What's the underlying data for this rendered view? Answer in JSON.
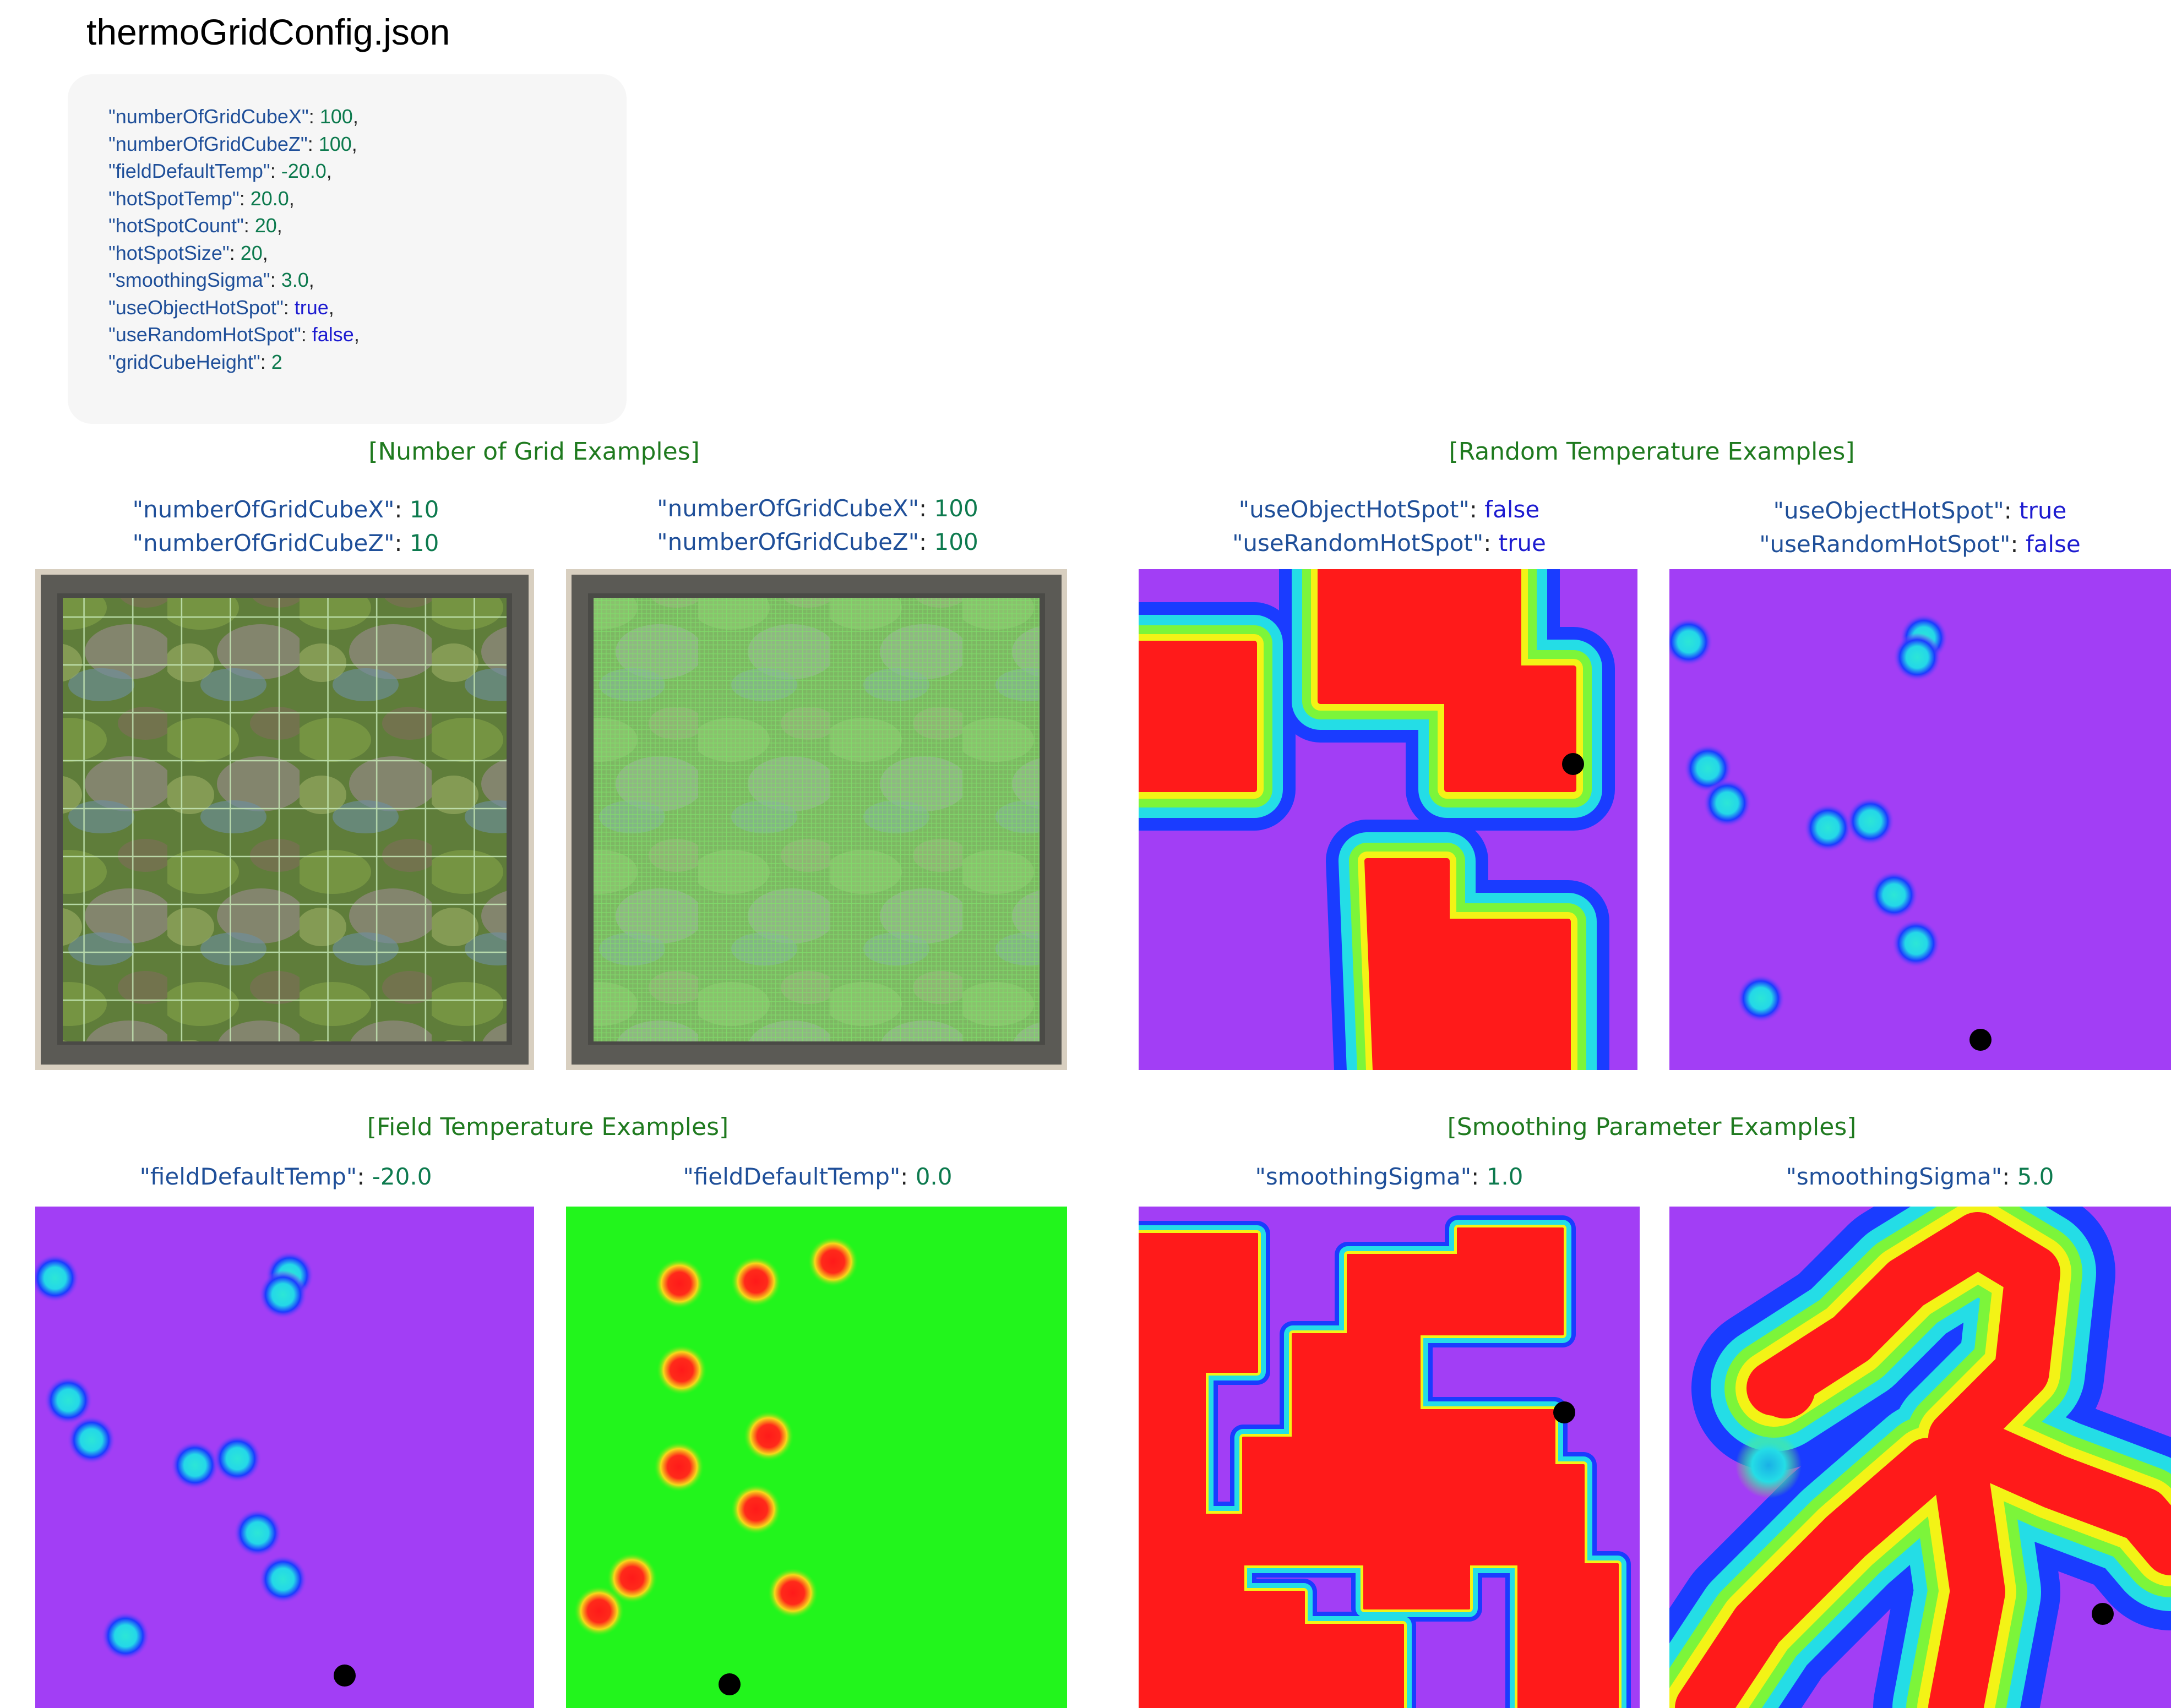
{
  "file_title": "thermoGridConfig.json",
  "config": [
    {
      "key": "\"numberOfGridCubeX\"",
      "value": "100",
      "type": "num",
      "trail": ","
    },
    {
      "key": "\"numberOfGridCubeZ\"",
      "value": "100",
      "type": "num",
      "trail": ","
    },
    {
      "key": "\"fieldDefaultTemp\"",
      "value": "-20.0",
      "type": "num",
      "trail": ","
    },
    {
      "key": "\"hotSpotTemp\"",
      "value": "20.0",
      "type": "num",
      "trail": ","
    },
    {
      "key": "\"hotSpotCount\"",
      "value": "20",
      "type": "num",
      "trail": ","
    },
    {
      "key": "\"hotSpotSize\"",
      "value": "20",
      "type": "num",
      "trail": ","
    },
    {
      "key": "\"smoothingSigma\"",
      "value": "3.0",
      "type": "num",
      "trail": ","
    },
    {
      "key": "\"useObjectHotSpot\"",
      "value": "true",
      "type": "bool",
      "trail": ","
    },
    {
      "key": "\"useRandomHotSpot\"",
      "value": "false",
      "type": "bool",
      "trail": ","
    },
    {
      "key": "\"gridCubeHeight\"",
      "value": "2",
      "type": "num",
      "trail": ""
    }
  ],
  "sections": {
    "grid": "[Number of Grid Examples]",
    "random": "[Random Temperature Examples]",
    "field": "[Field Temperature Examples]",
    "smoothing": "[Smoothing Parameter Examples]"
  },
  "labels": {
    "grid10": [
      {
        "key": "\"numberOfGridCubeX\"",
        "value": "10",
        "type": "num"
      },
      {
        "key": "\"numberOfGridCubeZ\"",
        "value": "10",
        "type": "num"
      }
    ],
    "grid100": [
      {
        "key": "\"numberOfGridCubeX\"",
        "value": "100",
        "type": "num"
      },
      {
        "key": "\"numberOfGridCubeZ\"",
        "value": "100",
        "type": "num"
      }
    ],
    "random_on": [
      {
        "key": "\"useObjectHotSpot\"",
        "value": "false",
        "type": "bool"
      },
      {
        "key": "\"useRandomHotSpot\"",
        "value": "true",
        "type": "bool"
      }
    ],
    "object_on": [
      {
        "key": "\"useObjectHotSpot\"",
        "value": "true",
        "type": "bool"
      },
      {
        "key": "\"useRandomHotSpot\"",
        "value": "false",
        "type": "bool"
      }
    ],
    "field_neg20": [
      {
        "key": "\"fieldDefaultTemp\"",
        "value": "-20.0",
        "type": "num"
      }
    ],
    "field_0": [
      {
        "key": "\"fieldDefaultTemp\"",
        "value": "0.0",
        "type": "num"
      }
    ],
    "sigma1": [
      {
        "key": "\"smoothingSigma\"",
        "value": "1.0",
        "type": "num"
      }
    ],
    "sigma5": [
      {
        "key": "\"smoothingSigma\"",
        "value": "5.0",
        "type": "num"
      }
    ]
  },
  "colors": {
    "cold": "#a23ef5",
    "hot": "#ff1a1a",
    "neutral": "#22f51c",
    "mid_cyan": "#24dde6",
    "mid_blue": "#1a3cff",
    "mid_yellow": "#f3f316",
    "marker": "#000000",
    "section_title": "#1f7a1f",
    "key_text": "#1f4f99",
    "number_text": "#0d7a4e",
    "bool_text": "#1d1bd0"
  }
}
